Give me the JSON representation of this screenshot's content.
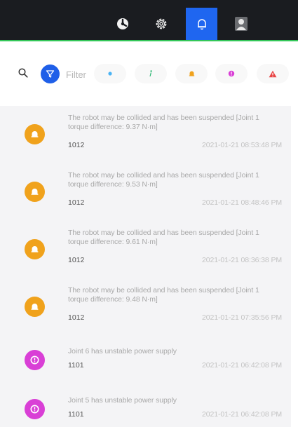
{
  "nav": {
    "items": [
      {
        "icon": "robot-arm-icon",
        "active": false
      },
      {
        "icon": "gear-icon",
        "active": false
      },
      {
        "icon": "bell-icon",
        "active": true
      },
      {
        "icon": "user-icon",
        "active": false
      }
    ],
    "accent": "#1f66f0",
    "status_line_color": "#34c759"
  },
  "filter": {
    "label": "Filter",
    "pills": [
      {
        "icon": "dot-icon",
        "color": "#4ab3f4"
      },
      {
        "icon": "info-icon",
        "color": "#2bb673"
      },
      {
        "icon": "bell-icon",
        "color": "#f0a21c"
      },
      {
        "icon": "error-icon",
        "color": "#d93fd6"
      },
      {
        "icon": "warning-icon",
        "color": "#e84545"
      }
    ]
  },
  "notifications": [
    {
      "type": "bell",
      "color": "#f0a21c",
      "line1": "The robot may be collided and has been suspended [Joint 1",
      "line2": "torque difference: 9.37 N·m]",
      "code": "1012",
      "time": "2021-01-21 08:53:48 PM"
    },
    {
      "type": "bell",
      "color": "#f0a21c",
      "line1": "The robot may be collided and has been suspended [Joint 1",
      "line2": "torque difference: 9.53 N·m]",
      "code": "1012",
      "time": "2021-01-21 08:48:46 PM"
    },
    {
      "type": "bell",
      "color": "#f0a21c",
      "line1": "The robot may be collided and has been suspended [Joint 1",
      "line2": "torque difference: 9.61 N·m]",
      "code": "1012",
      "time": "2021-01-21 08:36:38 PM"
    },
    {
      "type": "bell",
      "color": "#f0a21c",
      "line1": "The robot may be collided and has been suspended [Joint 1",
      "line2": "torque difference: 9.48 N·m]",
      "code": "1012",
      "time": "2021-01-21 07:35:56 PM"
    },
    {
      "type": "error",
      "color": "#d93fd6",
      "line1": "Joint 6 has unstable power supply",
      "line2": "",
      "code": "1101",
      "time": "2021-01-21 06:42:08 PM"
    },
    {
      "type": "error",
      "color": "#d93fd6",
      "line1": "Joint 5 has unstable power supply",
      "line2": "",
      "code": "1101",
      "time": "2021-01-21 06:42:08 PM"
    }
  ]
}
